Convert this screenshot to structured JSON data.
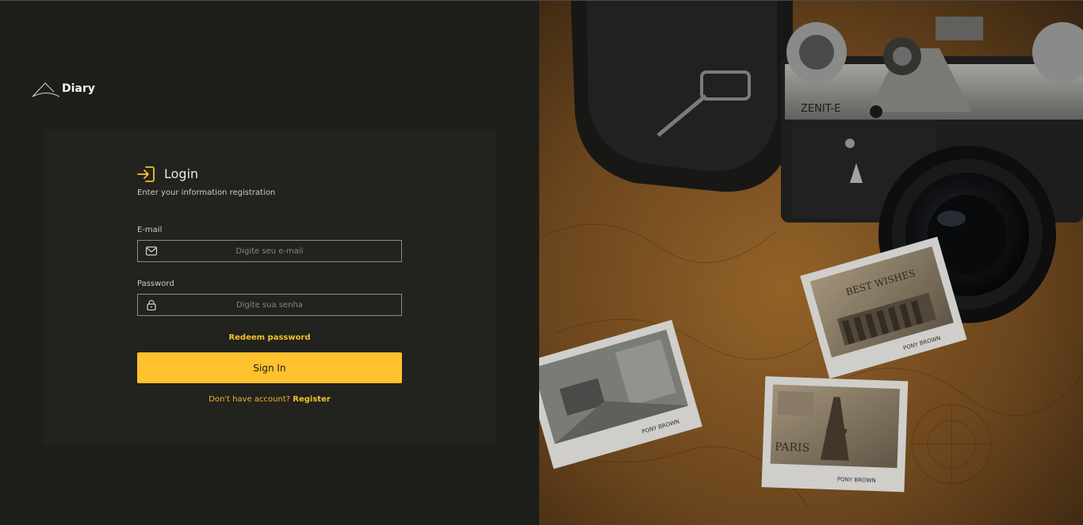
{
  "brand": {
    "name": "Diary",
    "icon": "mountain-logo-icon"
  },
  "login": {
    "title": "Login",
    "title_icon": "login-arrow-icon",
    "subtitle": "Enter your information registration",
    "email": {
      "label": "E-mail",
      "placeholder": "Digite seu e-mail",
      "value": "",
      "icon": "mail-icon"
    },
    "password": {
      "label": "Password",
      "placeholder": "Digite sua senha",
      "value": "",
      "icon": "lock-icon"
    },
    "redeem_label": "Redeem password",
    "submit_label": "Sign In",
    "register_prompt": "Don't have account?",
    "register_label": "Register"
  },
  "hero": {
    "camera_brand": "ZENIT-E",
    "photo_captions": [
      "BEST WISHES",
      "PARIS"
    ],
    "photo_signature": "PONY BROWN"
  },
  "colors": {
    "accent": "#ffc12e",
    "background": "#1e1e1b",
    "card": "#22221f"
  }
}
